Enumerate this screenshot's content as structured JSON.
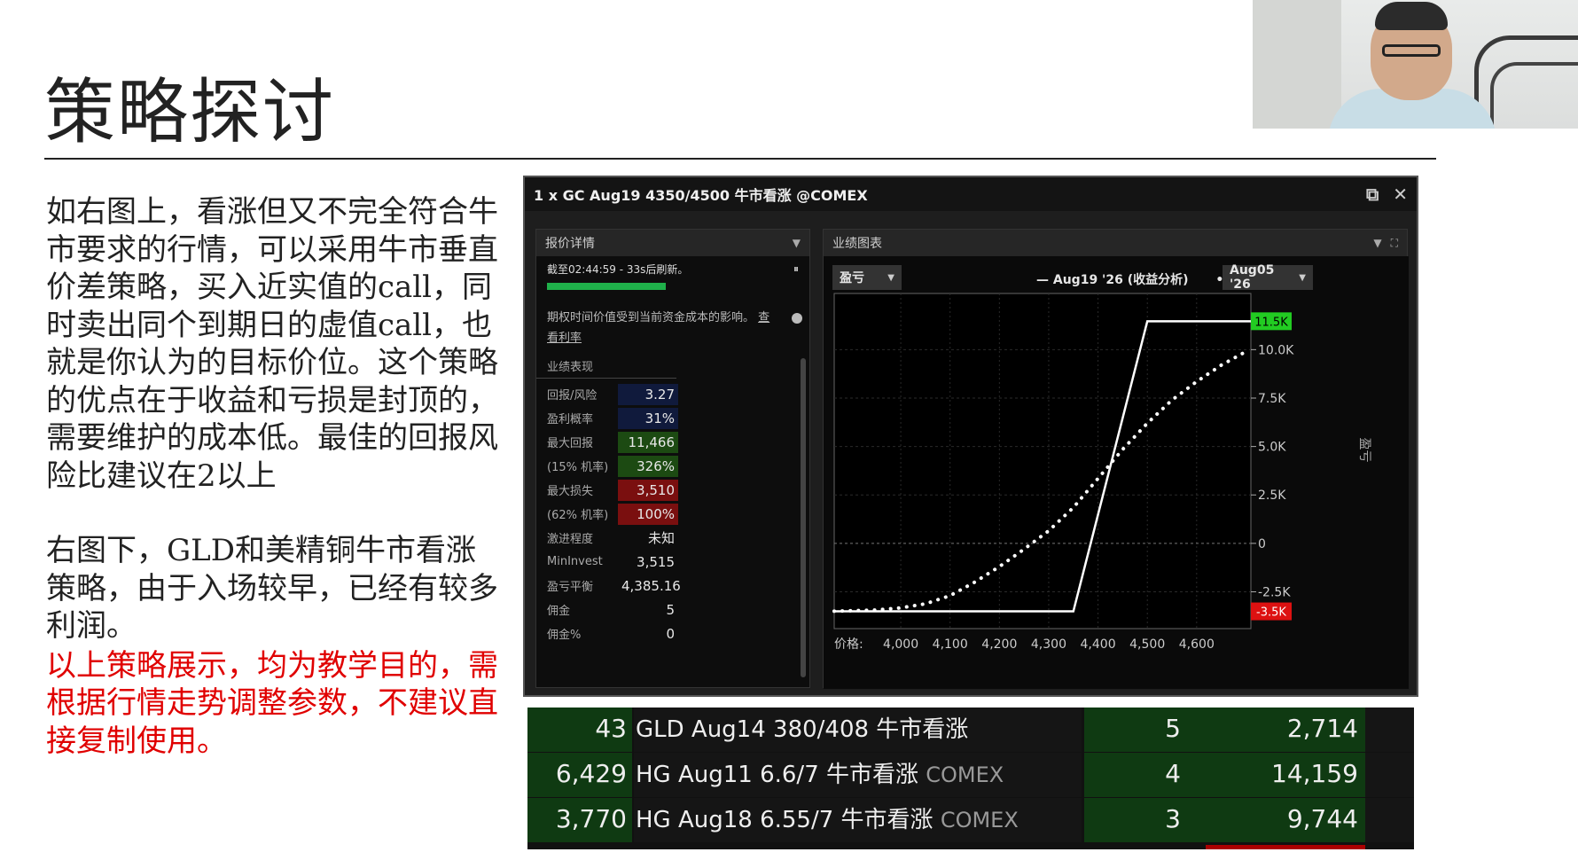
{
  "slide": {
    "title": "策略探讨",
    "paragraph1": "如右图上，看涨但又不完全符合牛市要求的行情，可以采用牛市垂直价差策略，买入近实值的call，同时卖出同个到期日的虚值call，也就是你认为的目标价位。这个策略的优点在于收益和亏损是封顶的，需要维护的成本低。最佳的回报风险比建议在2以上",
    "paragraph2": "右图下，GLD和美精铜牛市看涨策略，由于入场较早，已经有较多利润。",
    "warning": "以上策略展示，均为教学目的，需根据行情走势调整参数，不建议直接复制使用。"
  },
  "window": {
    "title": "1 x GC Aug19 4350/4500 牛市看涨 @COMEX",
    "popout_icon": "popout-icon",
    "close_icon": "close-icon"
  },
  "quote_panel": {
    "title": "报价详情",
    "refresh_text": "截至02:44:59 - 33s后刷新。",
    "pause_glyph": "⏸",
    "progress": 0.42,
    "note": "期权时间价值受到当前资金成本的影响。",
    "note_link": "查看利率",
    "metrics_title": "业绩表现",
    "metrics": [
      {
        "label": "回报/风险",
        "value": "3.27",
        "style": "blue"
      },
      {
        "label": "盈利概率",
        "value": "31%",
        "style": "blue"
      },
      {
        "label": "最大回报",
        "value": "11,466",
        "style": "green"
      },
      {
        "label": "(15% 机率)",
        "value": "326%",
        "style": "green"
      },
      {
        "label": "最大损失",
        "value": "3,510",
        "style": "red"
      },
      {
        "label": "(62% 机率)",
        "value": "100%",
        "style": "red"
      },
      {
        "label": "激进程度",
        "value": "未知",
        "style": ""
      },
      {
        "label": "MinInvest",
        "value": "3,515",
        "style": ""
      },
      {
        "label": "盈亏平衡",
        "value": "4,385.16",
        "style": ""
      },
      {
        "label": "佣金",
        "value": "5",
        "style": ""
      },
      {
        "label": "佣金%",
        "value": "0",
        "style": ""
      }
    ]
  },
  "chart_panel": {
    "title": "业绩图表",
    "dropdown_left": "盈亏",
    "legend_line": "— Aug19 '26 (收益分析)",
    "legend_dots": "• •",
    "dropdown_right": "Aug05 '26"
  },
  "chart_data": {
    "type": "line",
    "xlabel": "价格:",
    "ylabel": "盈亏",
    "x_ticks": [
      4000,
      4100,
      4200,
      4300,
      4400,
      4500,
      4600
    ],
    "x_tick_labels": [
      "4,000",
      "4,100",
      "4,200",
      "4,300",
      "4,400",
      "4,500",
      "4,600"
    ],
    "y_ticks": [
      -2500,
      0,
      2500,
      5000,
      7500,
      10000
    ],
    "y_tick_labels": [
      "-2.5K",
      "0",
      "2.5K",
      "5.0K",
      "7.5K",
      "10.0K"
    ],
    "xlim": [
      3865,
      4710
    ],
    "ylim": [
      -4400,
      12900
    ],
    "max_label": "11.5K",
    "min_label": "-3.5K",
    "max_value": 11466,
    "min_value": -3510,
    "colors": {
      "max": "#22cc22",
      "min": "#dd1111",
      "line": "#ffffff"
    },
    "series": [
      {
        "name": "Aug19 '26 (收益分析)",
        "style": "solid",
        "x": [
          3865,
          4350,
          4500,
          4710
        ],
        "y": [
          -3510,
          -3510,
          11466,
          11466
        ]
      },
      {
        "name": "Aug05 '26",
        "style": "dotted",
        "x": [
          3865,
          3950,
          4000,
          4050,
          4100,
          4150,
          4200,
          4250,
          4300,
          4350,
          4400,
          4450,
          4500,
          4550,
          4600,
          4650,
          4700
        ],
        "y": [
          -3500,
          -3440,
          -3330,
          -3120,
          -2700,
          -2000,
          -1200,
          -300,
          650,
          1850,
          3350,
          4850,
          6200,
          7400,
          8350,
          9200,
          9900
        ]
      }
    ]
  },
  "positions": [
    {
      "qty": "43",
      "name": "GLD Aug14 380/408 牛市看涨",
      "exchange": "",
      "days": "5",
      "pnl": "2,714"
    },
    {
      "qty": "6,429",
      "name": "HG Aug11 6.6/7 牛市看涨",
      "exchange": "COMEX",
      "days": "4",
      "pnl": "14,159"
    },
    {
      "qty": "3,770",
      "name": "HG Aug18 6.55/7 牛市看涨",
      "exchange": "COMEX",
      "days": "3",
      "pnl": "9,744"
    }
  ]
}
